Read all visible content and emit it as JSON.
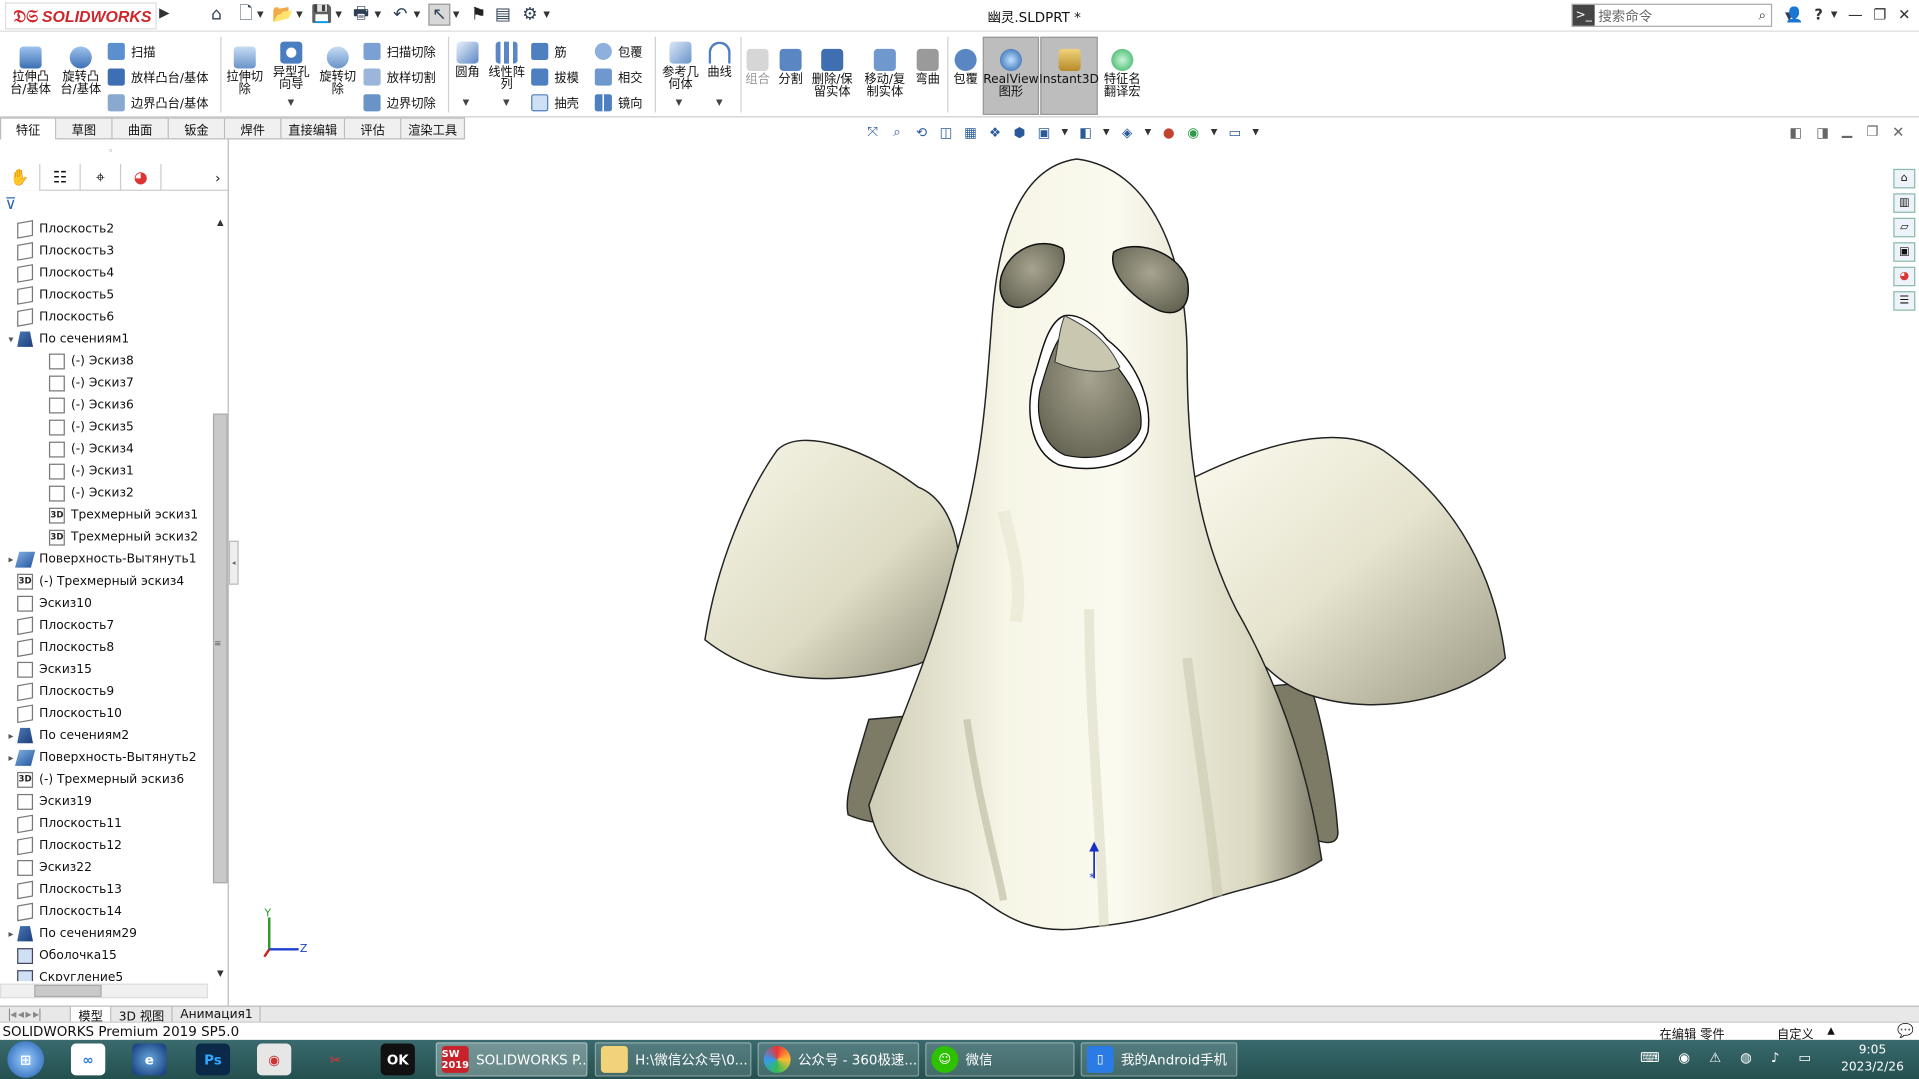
{
  "app": {
    "brand": "SOLIDWORKS",
    "doc_title": "幽灵.SLDPRT *"
  },
  "search": {
    "placeholder": "搜索命令"
  },
  "ribbon": {
    "extrude_boss": "拉伸凸\n台/基体",
    "revolve_boss": "旋转凸\n台/基体",
    "sweep": "扫描",
    "loft_boss": "放样凸台/基体",
    "boundary_boss": "边界凸台/基体",
    "extrude_cut": "拉伸切\n除",
    "hole_wizard": "异型孔\n向导",
    "revolve_cut": "旋转切\n除",
    "swept_cut": "扫描切除",
    "lofted_cut": "放样切割",
    "boundary_cut": "边界切除",
    "fillet": "圆角",
    "linear_pattern": "线性阵\n列",
    "rib": "筋",
    "draft": "拔模",
    "shell": "抽壳",
    "wrap": "包覆",
    "intersect": "相交",
    "mirror": "镜向",
    "ref_geometry": "参考几\n何体",
    "curves": "曲线",
    "combine": "组合",
    "split": "分割",
    "delete_body": "删除/保\n留实体",
    "move_copy": "移动/复\n制实体",
    "flex": "弯曲",
    "wrap2": "包覆",
    "realview": "RealView\n图形",
    "instant3d": "Instant3D",
    "translate": "特征名\n翻译宏"
  },
  "tabs": [
    "特征",
    "草图",
    "曲面",
    "钣金",
    "焊件",
    "直接编辑",
    "评估",
    "渲染工具"
  ],
  "tree": [
    {
      "label": "Плоскость2",
      "icon": "plane-icon",
      "indent": 0,
      "exp": ""
    },
    {
      "label": "Плоскость3",
      "icon": "plane-icon",
      "indent": 0,
      "exp": ""
    },
    {
      "label": "Плоскость4",
      "icon": "plane-icon",
      "indent": 0,
      "exp": ""
    },
    {
      "label": "Плоскость5",
      "icon": "plane-icon",
      "indent": 0,
      "exp": ""
    },
    {
      "label": "Плоскость6",
      "icon": "plane-icon",
      "indent": 0,
      "exp": ""
    },
    {
      "label": "По сечениям1",
      "icon": "loft-icon",
      "indent": 0,
      "exp": "▾"
    },
    {
      "label": "(-) Эскиз8",
      "icon": "sketch-icon",
      "indent": 1,
      "exp": ""
    },
    {
      "label": "(-) Эскиз7",
      "icon": "sketch-icon",
      "indent": 1,
      "exp": ""
    },
    {
      "label": "(-) Эскиз6",
      "icon": "sketch-icon",
      "indent": 1,
      "exp": ""
    },
    {
      "label": "(-) Эскиз5",
      "icon": "sketch-icon",
      "indent": 1,
      "exp": ""
    },
    {
      "label": "(-) Эскиз4",
      "icon": "sketch-icon",
      "indent": 1,
      "exp": ""
    },
    {
      "label": "(-) Эскиз1",
      "icon": "sketch-icon",
      "indent": 1,
      "exp": ""
    },
    {
      "label": "(-) Эскиз2",
      "icon": "sketch-icon",
      "indent": 1,
      "exp": ""
    },
    {
      "label": "Трехмерный эскиз1",
      "icon": "3d-sketch-icon",
      "indent": 1,
      "exp": ""
    },
    {
      "label": "Трехмерный эскиз2",
      "icon": "3d-sketch-icon",
      "indent": 1,
      "exp": ""
    },
    {
      "label": "Поверхность-Вытянуть1",
      "icon": "surface-icon",
      "indent": 0,
      "exp": "▸"
    },
    {
      "label": "(-) Трехмерный эскиз4",
      "icon": "3d-sketch-icon",
      "indent": 0,
      "exp": ""
    },
    {
      "label": "Эскиз10",
      "icon": "sketch-icon",
      "indent": 0,
      "exp": ""
    },
    {
      "label": "Плоскость7",
      "icon": "plane-icon",
      "indent": 0,
      "exp": ""
    },
    {
      "label": "Плоскость8",
      "icon": "plane-icon",
      "indent": 0,
      "exp": ""
    },
    {
      "label": "Эскиз15",
      "icon": "sketch-icon",
      "indent": 0,
      "exp": ""
    },
    {
      "label": "Плоскость9",
      "icon": "plane-icon",
      "indent": 0,
      "exp": ""
    },
    {
      "label": "Плоскость10",
      "icon": "plane-icon",
      "indent": 0,
      "exp": ""
    },
    {
      "label": "По сечениям2",
      "icon": "loft-icon",
      "indent": 0,
      "exp": "▸"
    },
    {
      "label": "Поверхность-Вытянуть2",
      "icon": "surface-icon",
      "indent": 0,
      "exp": "▸"
    },
    {
      "label": "(-) Трехмерный эскиз6",
      "icon": "3d-sketch-icon",
      "indent": 0,
      "exp": ""
    },
    {
      "label": "Эскиз19",
      "icon": "sketch-icon",
      "indent": 0,
      "exp": ""
    },
    {
      "label": "Плоскость11",
      "icon": "plane-icon",
      "indent": 0,
      "exp": ""
    },
    {
      "label": "Плоскость12",
      "icon": "plane-icon",
      "indent": 0,
      "exp": ""
    },
    {
      "label": "Эскиз22",
      "icon": "sketch-icon",
      "indent": 0,
      "exp": ""
    },
    {
      "label": "Плоскость13",
      "icon": "plane-icon",
      "indent": 0,
      "exp": ""
    },
    {
      "label": "Плоскость14",
      "icon": "plane-icon",
      "indent": 0,
      "exp": ""
    },
    {
      "label": "По сечениям29",
      "icon": "loft-icon",
      "indent": 0,
      "exp": "▸"
    },
    {
      "label": "Оболочка15",
      "icon": "shell-icon",
      "indent": 0,
      "exp": ""
    },
    {
      "label": "Скругление5",
      "icon": "fillet-icon",
      "indent": 0,
      "exp": ""
    }
  ],
  "bottom_tabs": [
    "模型",
    "3D 视图",
    "Анимация1"
  ],
  "status": {
    "left": "SOLIDWORKS Premium 2019 SP5.0",
    "mode": "在编辑 零件",
    "custom": "自定义"
  },
  "taskbar": {
    "apps": [
      {
        "label": "SOLIDWORKS P...",
        "badge": "SW\n2019"
      },
      {
        "label": "H:\\微信公众号\\0..."
      },
      {
        "label": "公众号 - 360极速..."
      },
      {
        "label": "微信"
      },
      {
        "label": "我的Android手机"
      }
    ],
    "time": "9:05",
    "date": "2023/2/26"
  },
  "axis": {
    "y": "Y",
    "z": "Z"
  },
  "colors": {
    "ghost": "#efeed9",
    "brand_red": "#d1252a",
    "taskbar": "#2d5a5b"
  }
}
